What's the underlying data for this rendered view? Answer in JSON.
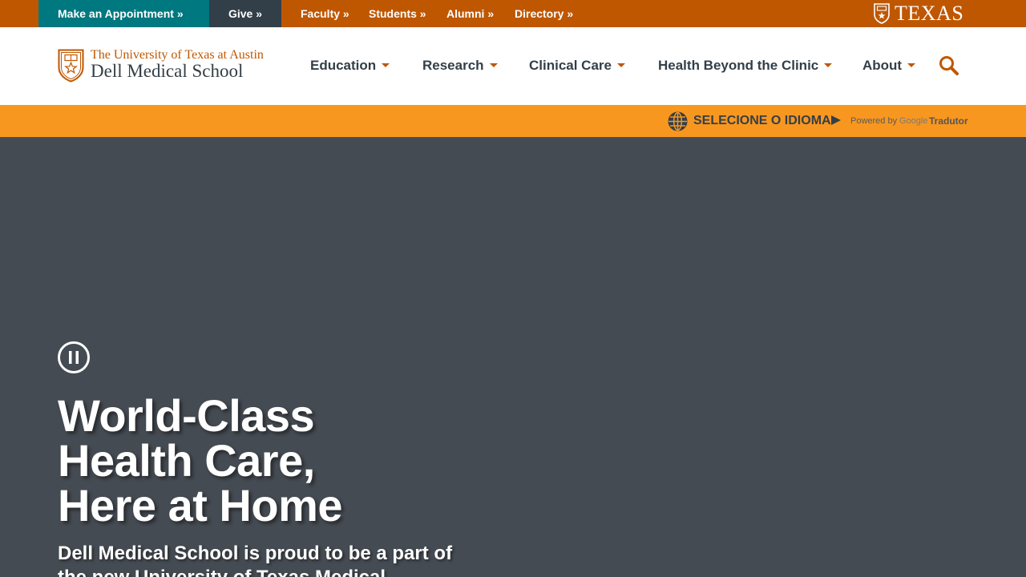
{
  "utility": {
    "appointment": "Make an Appointment »",
    "give": "Give »",
    "faculty": "Faculty »",
    "students": "Students »",
    "alumni": "Alumni »",
    "directory": "Directory »",
    "texas": "TEXAS"
  },
  "brand": {
    "line1": "The University of Texas at Austin",
    "line2": "Dell Medical School"
  },
  "nav": {
    "education": "Education",
    "research": "Research",
    "clinical_care": "Clinical Care",
    "health_beyond": "Health Beyond the Clinic",
    "about": "About"
  },
  "translate": {
    "select_label": "SELECIONE O IDIOMA",
    "powered_by": "Powered by",
    "google": "Google",
    "tradutor": "Tradutor"
  },
  "hero": {
    "title_line1": "World-Class",
    "title_line2": "Health Care,",
    "title_line3": "Here at Home",
    "subtitle": "Dell Medical School is proud to be a part of the new University of Texas Medical"
  },
  "icons": {
    "search": "search-icon",
    "globe": "globe-icon",
    "pause": "pause-icon",
    "shield": "shield-icon"
  },
  "colors": {
    "burnt_orange": "#bf5700",
    "teal": "#00787f",
    "charcoal": "#333f48",
    "translate_bar": "#f8971f",
    "hero_bg": "#454b52"
  }
}
